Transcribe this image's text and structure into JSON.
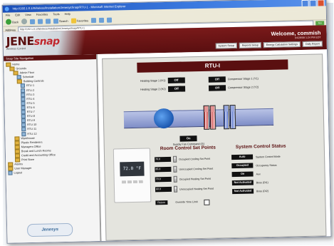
{
  "browser": {
    "title": "http://192.1.0.1/Wireless/Installation/JenesysSnap/RTU-1 - Microsoft Internet Explorer",
    "menu": [
      "File",
      "Edit",
      "View",
      "Favorites",
      "Tools",
      "Help"
    ],
    "toolbar": {
      "back": "Back",
      "search": "Search",
      "favorites": "Favorites"
    },
    "address_label": "Address",
    "address": "http://192.1.0.1/Wireless/Installation/JenesysSnap/RTU-1",
    "go": "Go"
  },
  "header": {
    "logo_main": "JENE",
    "logo_snap": "snap",
    "logo_sub": "Wireless Control",
    "welcome": "Welcome, commish",
    "datetime": "04/28/08 1:24 PM EDT",
    "nav": [
      "System Setup",
      "Reports Setup",
      "Energy Calculation Settings",
      "Daily Report"
    ]
  },
  "sidebar": {
    "title": "Snap Site Navigation",
    "items": [
      {
        "label": "Home",
        "indent": 0,
        "kind": "fold"
      },
      {
        "label": "Grounds",
        "indent": 1,
        "kind": "fold"
      },
      {
        "label": "Admin Floor",
        "indent": 2,
        "kind": "fold"
      },
      {
        "label": "Schedule",
        "indent": 3,
        "kind": "dev"
      },
      {
        "label": "Building Controls",
        "indent": 3,
        "kind": "fold"
      },
      {
        "label": "RTU-1",
        "indent": 4,
        "kind": "dev"
      },
      {
        "label": "RTU-2",
        "indent": 4,
        "kind": "dev"
      },
      {
        "label": "RTU-3",
        "indent": 4,
        "kind": "dev"
      },
      {
        "label": "RTU-4",
        "indent": 4,
        "kind": "dev"
      },
      {
        "label": "RTU-5",
        "indent": 4,
        "kind": "dev"
      },
      {
        "label": "RTU-6",
        "indent": 4,
        "kind": "dev"
      },
      {
        "label": "RTU-7",
        "indent": 4,
        "kind": "dev"
      },
      {
        "label": "RTU-8",
        "indent": 4,
        "kind": "dev"
      },
      {
        "label": "RTU-9",
        "indent": 4,
        "kind": "dev"
      },
      {
        "label": "RTU-10",
        "indent": 4,
        "kind": "dev"
      },
      {
        "label": "RTU-11",
        "indent": 4,
        "kind": "dev"
      },
      {
        "label": "RTU-12",
        "indent": 4,
        "kind": "dev"
      },
      {
        "label": "Warehouse",
        "indent": 2,
        "kind": "fold"
      },
      {
        "label": "Plastic Renderers",
        "indent": 2,
        "kind": "fold"
      },
      {
        "label": "Managers Office",
        "indent": 2,
        "kind": "fold"
      },
      {
        "label": "Break and Lunch Rooms",
        "indent": 2,
        "kind": "fold"
      },
      {
        "label": "Credit and Accounting Office",
        "indent": 2,
        "kind": "fold"
      },
      {
        "label": "Print Store",
        "indent": 2,
        "kind": "fold"
      },
      {
        "label": "Alarms",
        "indent": 0,
        "kind": "fold"
      },
      {
        "label": "User Manager",
        "indent": 0,
        "kind": "fold"
      },
      {
        "label": "Logout",
        "indent": 0,
        "kind": "dev"
      }
    ],
    "footer_logo": "Jenesys"
  },
  "panel": {
    "title": "RTU-I",
    "heating1": {
      "label": "Heating Stage 1 (H1)",
      "value": "Off"
    },
    "heating2": {
      "label": "Heating Stage 2 (H2)",
      "value": "Off"
    },
    "comp1": {
      "label": "Compressor Stage 1 (Y1)",
      "value": "Off"
    },
    "comp2": {
      "label": "Compressor Stage 2 (Y2)",
      "value": "Off"
    },
    "supply_fan": {
      "label": "Supply Fan Command (G)",
      "value": "On"
    },
    "thermostat_display": "72.0 °F",
    "setpoints_title": "Room Control Set Points",
    "setpoints": [
      {
        "value": "76.0",
        "label": "Occupied Cooling Set Point"
      },
      {
        "value": "85.0",
        "label": "Unoccupied Cooling Set Point"
      },
      {
        "value": "70.0",
        "label": "Occupied Heating Set Point"
      },
      {
        "value": "60.0",
        "label": "Unoccupied Heating Set Point"
      }
    ],
    "status_title": "System Control Status",
    "status": [
      {
        "value": "Auto",
        "label": "System Control Mode"
      },
      {
        "value": "Occupied",
        "label": "Occupancy Status"
      },
      {
        "value": "On",
        "label": "Aux"
      },
      {
        "value": "Not Activated",
        "label": "Boss (DI1)"
      },
      {
        "value": "Not Activated",
        "label": "Boss (DI2)"
      }
    ],
    "return_btn": "Return",
    "override_label": "Override Time Limit"
  }
}
